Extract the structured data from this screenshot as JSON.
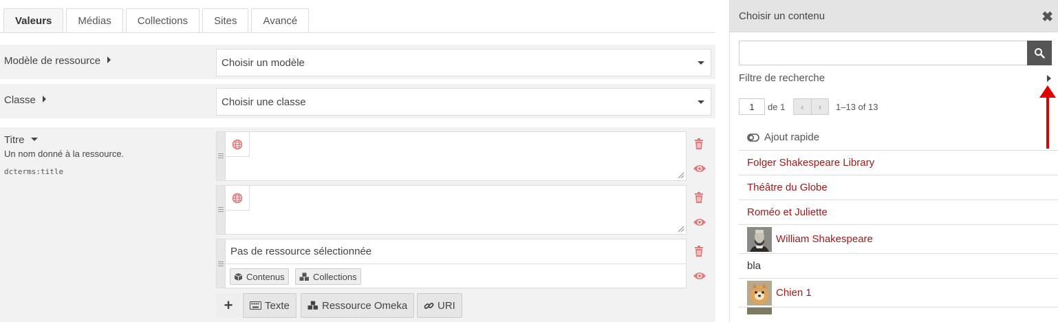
{
  "tabs": [
    "Valeurs",
    "Médias",
    "Collections",
    "Sites",
    "Avancé"
  ],
  "resource_template": {
    "label": "Modèle de ressource",
    "value": "Choisir un modèle"
  },
  "resource_class": {
    "label": "Classe",
    "value": "Choisir une classe"
  },
  "title_property": {
    "label": "Titre",
    "description": "Un nom donné à la ressource.",
    "term": "dcterms:title",
    "resource_value": "Pas de ressource sélectionnée",
    "resource_buttons": [
      "Contenus",
      "Collections"
    ]
  },
  "add_value_buttons": [
    "Texte",
    "Ressource Omeka",
    "URI"
  ],
  "sidebar": {
    "title": "Choisir un contenu",
    "search_value": "",
    "filter_label": "Filtre de recherche",
    "page": "1",
    "page_of": "de 1",
    "range": "1–13 of 13",
    "quick_add": "Ajout rapide",
    "items": [
      "Folger Shakespeare Library",
      "Théâtre du Globe",
      "Roméo et Juliette",
      "William Shakespeare",
      "bla",
      "Chien 1"
    ]
  },
  "colors": {
    "link": "#a3191b",
    "icon_red": "#e07a7a",
    "annotation_arrow": "#e00000"
  }
}
